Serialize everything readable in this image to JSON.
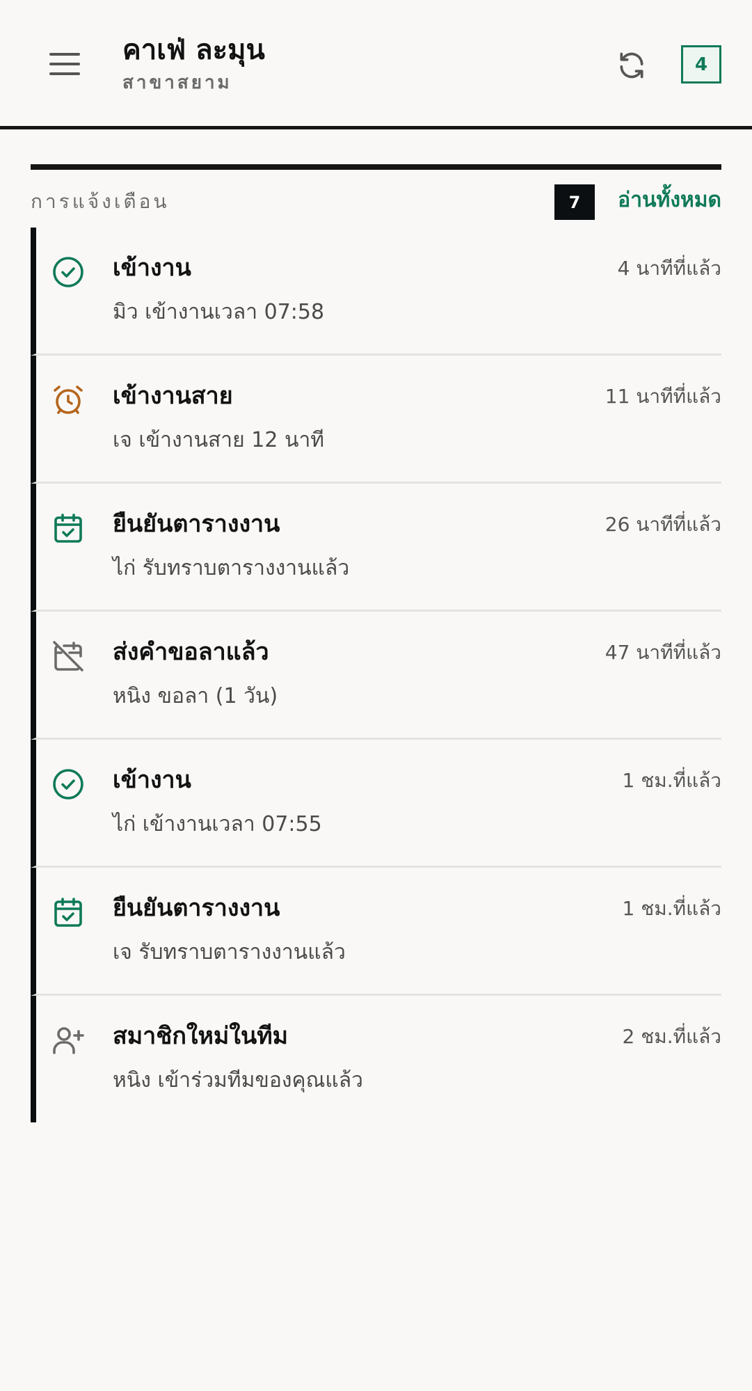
{
  "header": {
    "title": "คาเฟ่ ละมุน",
    "subtitle": "สาขาสยาม",
    "badge_count": "4"
  },
  "notifications_section": {
    "label": "การแจ้งเตือน",
    "unread_count": "7",
    "read_all_label": "อ่านทั้งหมด"
  },
  "notifications": [
    {
      "icon": "check-circle-icon",
      "title": "เข้างาน",
      "time": "4  นาทีที่แล้ว",
      "desc": "มิว เข้างานเวลา 07:58"
    },
    {
      "icon": "alarm-clock-icon",
      "title": "เข้างานสาย",
      "time": "11  นาทีที่แล้ว",
      "desc": "เจ เข้างานสาย 12 นาที"
    },
    {
      "icon": "calendar-check-icon",
      "title": "ยืนยันตารางงาน",
      "time": "26  นาทีที่แล้ว",
      "desc": "ไก่ รับทราบตารางงานแล้ว"
    },
    {
      "icon": "calendar-off-icon",
      "title": "ส่งคำขอลาแล้ว",
      "time": "47  นาทีที่แล้ว",
      "desc": "หนิง ขอลา (1 วัน)"
    },
    {
      "icon": "check-circle-icon",
      "title": "เข้างาน",
      "time": "1  ชม.ที่แล้ว",
      "desc": "ไก่ เข้างานเวลา 07:55"
    },
    {
      "icon": "calendar-check-icon",
      "title": "ยืนยันตารางงาน",
      "time": "1  ชม.ที่แล้ว",
      "desc": "เจ รับทราบตารางงานแล้ว"
    },
    {
      "icon": "user-plus-icon",
      "title": "สมาชิกใหม่ในทีม",
      "time": "2  ชม.ที่แล้ว",
      "desc": "หนิง เข้าร่วมทีมของคุณแล้ว"
    }
  ],
  "colors": {
    "accent": "#0f7a58",
    "warning": "#b5651d",
    "dark": "#0b0f11",
    "muted_icon": "#6b6b6b"
  }
}
